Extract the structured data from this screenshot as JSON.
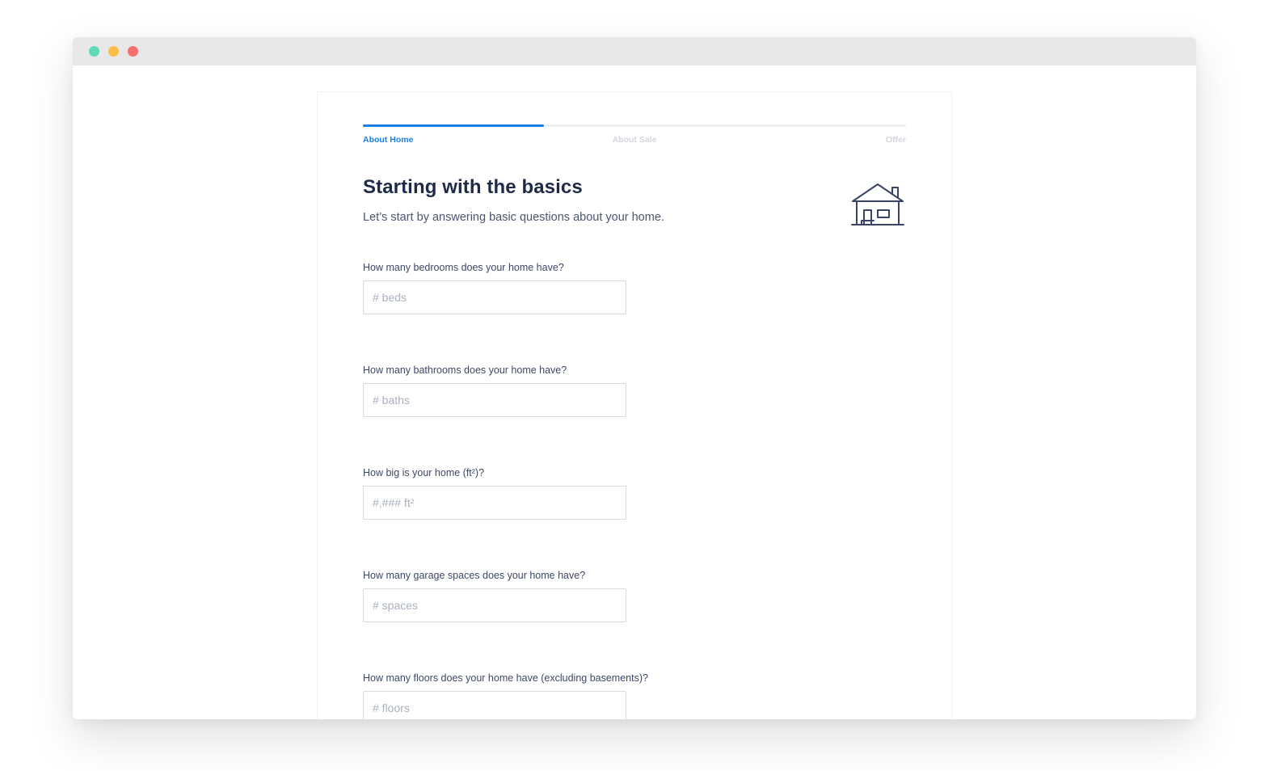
{
  "window": {
    "dots": [
      {
        "name": "close",
        "color": "#5fd9b8"
      },
      {
        "name": "minimize",
        "color": "#fdbd4a"
      },
      {
        "name": "maximize",
        "color": "#f76c6c"
      }
    ]
  },
  "progress": {
    "value": 0.333,
    "steps": [
      "About Home",
      "About Sale",
      "Offer"
    ],
    "active_step": 0
  },
  "header": {
    "title": "Starting with the basics",
    "subtitle": "Let’s start by answering basic questions about your home.",
    "icon": "house-icon"
  },
  "form": {
    "fields": [
      {
        "label": "How many bedrooms does your home have?",
        "placeholder": "# beds"
      },
      {
        "label": "How many bathrooms does your home have?",
        "placeholder": "# baths"
      },
      {
        "label": "How big is your home (ft²)?",
        "placeholder": "#,### ft²"
      },
      {
        "label": "How many garage spaces does your home have?",
        "placeholder": "# spaces"
      },
      {
        "label": "How many floors does your home have (excluding basements)?",
        "placeholder": "# floors"
      }
    ]
  },
  "colors": {
    "accent": "#1a7fe4",
    "heading": "#1e2a47",
    "text": "#4c5673",
    "inactive_step": "#d2d6dc"
  }
}
